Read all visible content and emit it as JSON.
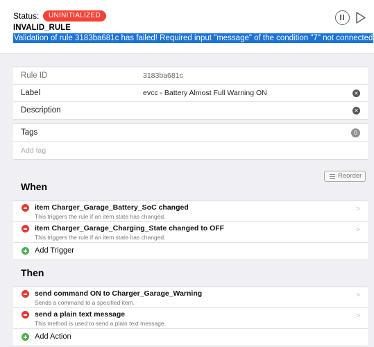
{
  "status": {
    "label": "Status:",
    "badge": "UNINITIALIZED",
    "detail": "INVALID_RULE",
    "message": "Validation of rule 3183ba681c has failed! Required input \"message\" of the condition \"7\" not connected"
  },
  "controls": {
    "pause_icon": "pause-circle-icon",
    "play_icon": "play-icon"
  },
  "details": {
    "rule_id_label": "Rule ID",
    "rule_id_value": "3183ba681c",
    "label_label": "Label",
    "label_value": "evcc - Battery Almost Full Warning ON",
    "description_label": "Description",
    "description_value": ""
  },
  "tags": {
    "label": "Tags",
    "count": "0",
    "add_placeholder": "Add tag"
  },
  "reorder_label": "Reorder",
  "when": {
    "title": "When",
    "items": [
      {
        "title": "item Charger_Garage_Battery_SoC changed",
        "desc": "This triggers the rule if an item state has changed."
      },
      {
        "title": "item Charger_Garage_Charging_State changed to OFF",
        "desc": "This triggers the rule if an item state has changed."
      }
    ],
    "add_label": "Add Trigger"
  },
  "then": {
    "title": "Then",
    "items": [
      {
        "title": "send command ON to Charger_Garage_Warning",
        "desc": "Sends a command to a specified item."
      },
      {
        "title": "send a plain text message",
        "desc": "This method is used to send a plain text message."
      }
    ],
    "add_label": "Add Action"
  },
  "colors": {
    "error": "#f44336",
    "remove": "#e53935",
    "add": "#4caf50",
    "selection": "#1a73d8"
  }
}
